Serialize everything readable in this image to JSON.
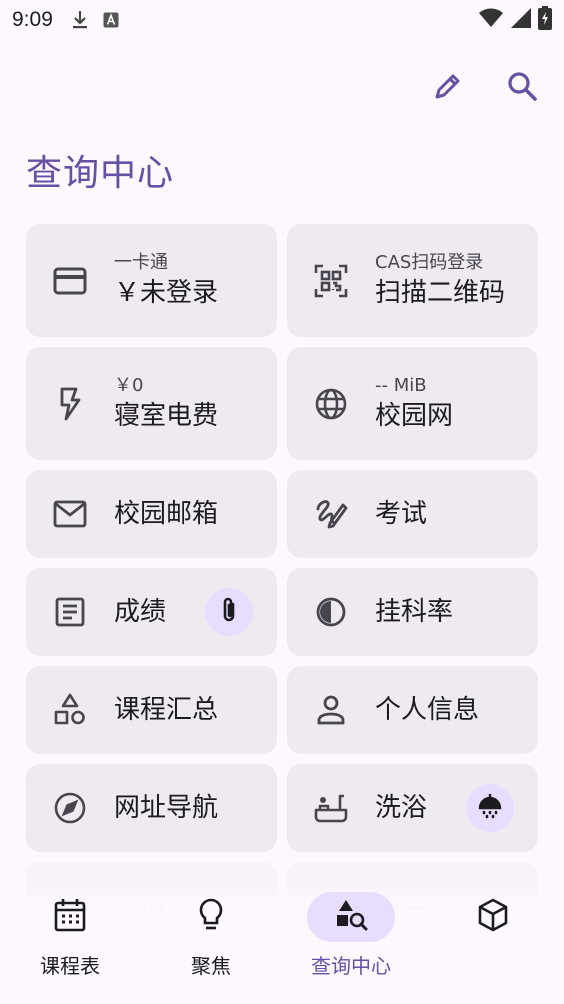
{
  "status_bar": {
    "time": "9:09"
  },
  "header": {
    "title": "查询中心"
  },
  "cards": [
    {
      "sub": "一卡通",
      "main": "￥未登录",
      "icon": "credit-card-icon"
    },
    {
      "sub": "CAS扫码登录",
      "main": "扫描二维码",
      "icon": "qr-code-scan-icon"
    },
    {
      "sub": "￥0",
      "main": "寝室电费",
      "icon": "lightning-bolt-icon"
    },
    {
      "sub": "-- MiB",
      "main": "校园网",
      "icon": "globe-icon"
    },
    {
      "main": "校园邮箱",
      "icon": "mail-icon"
    },
    {
      "main": "考试",
      "icon": "pen-scribble-icon"
    },
    {
      "main": "成绩",
      "icon": "document-list-icon",
      "badge": "paperclip-icon"
    },
    {
      "main": "挂科率",
      "icon": "half-circle-icon"
    },
    {
      "main": "课程汇总",
      "icon": "shapes-icon"
    },
    {
      "main": "个人信息",
      "icon": "person-icon"
    },
    {
      "main": "网址导航",
      "icon": "compass-icon"
    },
    {
      "main": "洗浴",
      "icon": "bath-icon",
      "badge": "shower-icon"
    },
    {
      "main": "选课",
      "icon": "target-icon"
    },
    {
      "main": "寝室",
      "icon": "bed-icon"
    }
  ],
  "bottom_nav": [
    {
      "label": "课程表",
      "icon": "calendar-icon",
      "active": false
    },
    {
      "label": "聚焦",
      "icon": "lightbulb-icon",
      "active": false
    },
    {
      "label": "查询中心",
      "icon": "shapes-search-icon",
      "active": true
    },
    {
      "label": "",
      "icon": "cube-icon",
      "active": false
    }
  ],
  "colors": {
    "accent": "#6750a4",
    "card_bg": "#efeaf0",
    "active_pill": "#e8ddff",
    "background": "#fcf8fd"
  }
}
